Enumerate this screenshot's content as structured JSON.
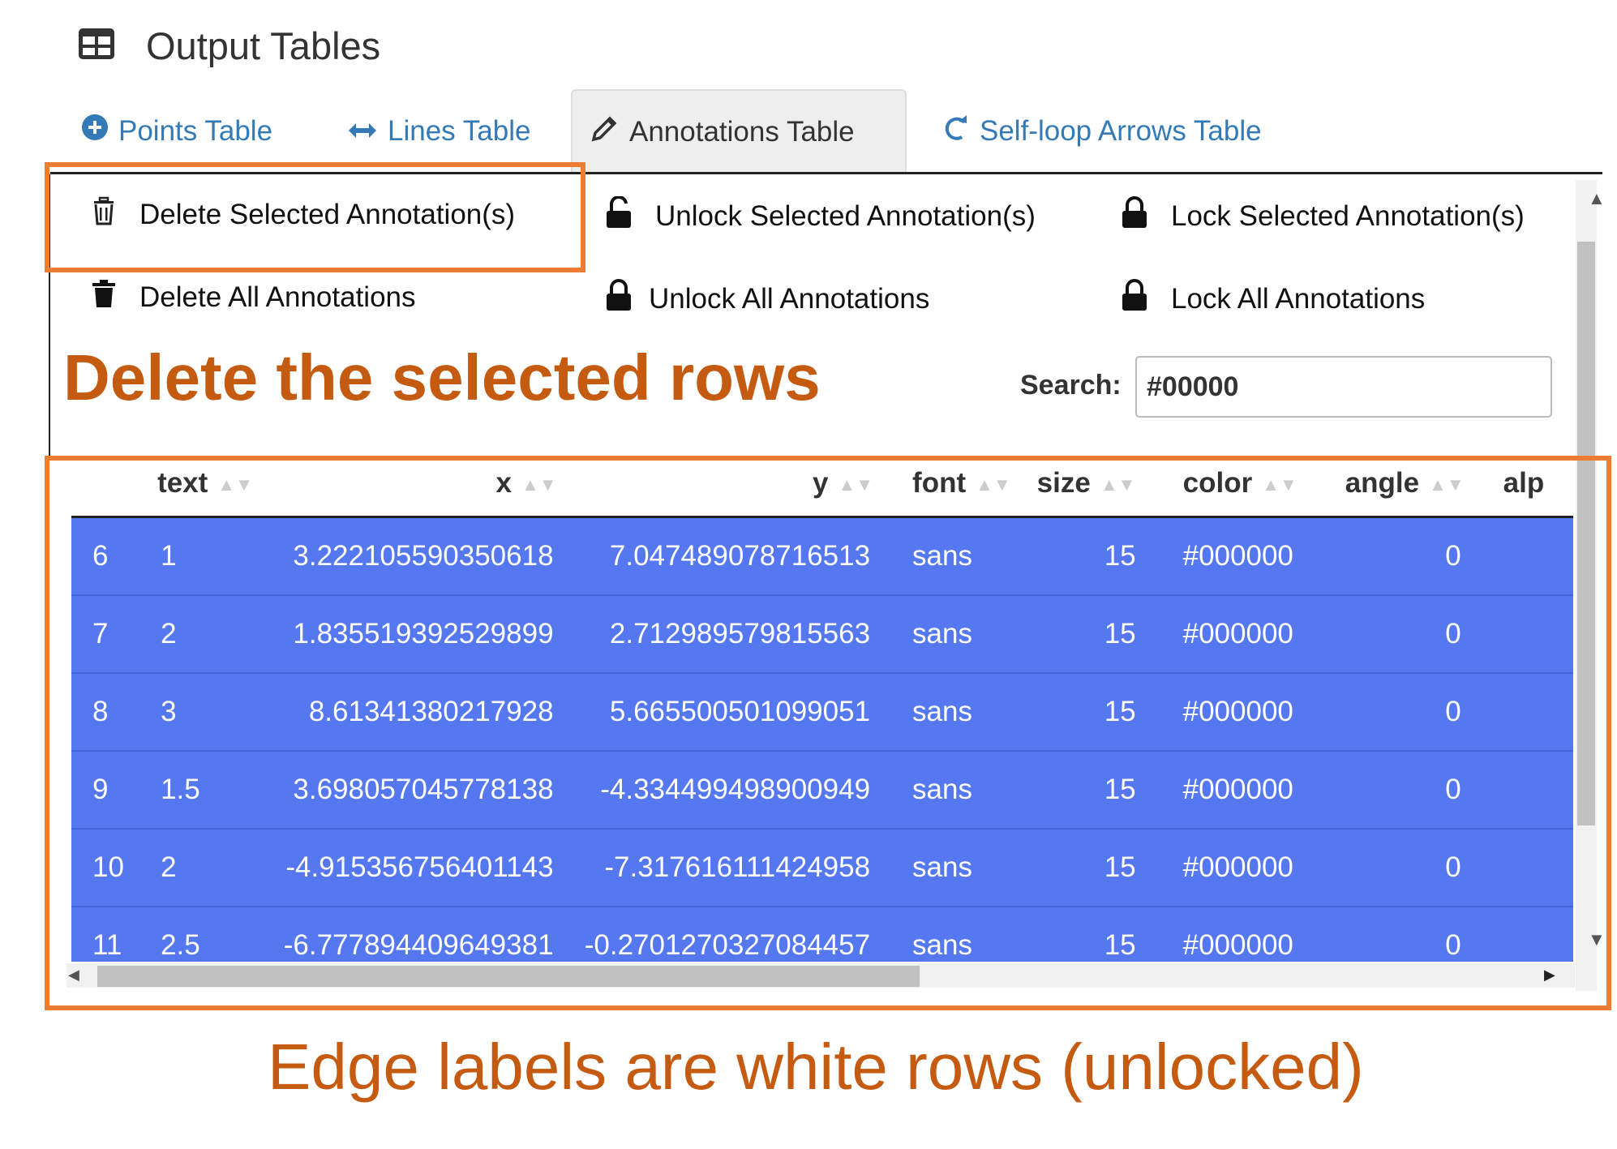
{
  "header": {
    "title": "Output Tables",
    "icon": "table-icon"
  },
  "tabs": [
    {
      "label": "Points Table",
      "icon": "plus-circle-icon",
      "active": false
    },
    {
      "label": "Lines Table",
      "icon": "arrows-horizontal-icon",
      "active": false
    },
    {
      "label": "Annotations Table",
      "icon": "pencil-icon",
      "active": true
    },
    {
      "label": "Self-loop Arrows Table",
      "icon": "redo-icon",
      "active": false
    }
  ],
  "buttons": {
    "delete_selected": "Delete Selected Annotation(s)",
    "unlock_selected": "Unlock Selected Annotation(s)",
    "lock_selected": "Lock Selected Annotation(s)",
    "delete_all": "Delete All Annotations",
    "unlock_all": "Unlock All Annotations",
    "lock_all": "Lock All Annotations"
  },
  "search": {
    "label": "Search:",
    "value": "#00000"
  },
  "annotations": {
    "title": "Delete the selected rows",
    "caption": "Edge labels are white rows (unlocked)",
    "highlight_color": "#ed7d31",
    "text_color": "#c55a11"
  },
  "table": {
    "columns": [
      "",
      "text",
      "x",
      "y",
      "font",
      "size",
      "color",
      "angle",
      "alp"
    ],
    "selected_row_color": "#5578f0",
    "rows": [
      [
        "6",
        "1",
        "3.222105590350618",
        "7.047489078716513",
        "sans",
        "15",
        "#000000",
        "0",
        ""
      ],
      [
        "7",
        "2",
        "1.835519392529899",
        "2.712989579815563",
        "sans",
        "15",
        "#000000",
        "0",
        ""
      ],
      [
        "8",
        "3",
        "8.61341380217928",
        "5.665500501099051",
        "sans",
        "15",
        "#000000",
        "0",
        ""
      ],
      [
        "9",
        "1.5",
        "3.698057045778138",
        "-4.334499498900949",
        "sans",
        "15",
        "#000000",
        "0",
        ""
      ],
      [
        "10",
        "2",
        "-4.915356756401143",
        "-7.317616111424958",
        "sans",
        "15",
        "#000000",
        "0",
        ""
      ],
      [
        "11",
        "2.5",
        "-6.777894409649381",
        "-0.2701270327084457",
        "sans",
        "15",
        "#000000",
        "0",
        ""
      ]
    ]
  }
}
